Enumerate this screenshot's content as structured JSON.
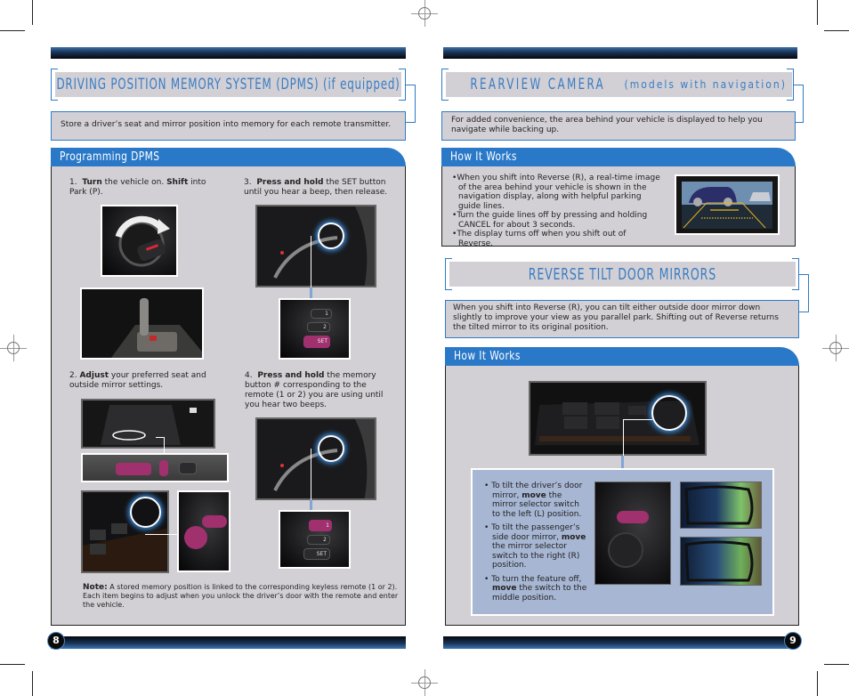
{
  "left_page": {
    "page_number": "8",
    "section_title": "DRIVING POSITION MEMORY SYSTEM (DPMS)",
    "section_title_suffix": "(if equipped)",
    "intro": "Store a driver’s seat and mirror position into memory for each remote transmitter.",
    "panel_title": "Programming DPMS",
    "steps": [
      {
        "num": "1.",
        "bold1": "Turn",
        "text1": " the vehicle on. ",
        "bold2": "Shift",
        "text2": " into Park (P)."
      },
      {
        "num": "2.",
        "bold1": "Adjust",
        "text1": " your preferred seat and outside mirror settings.",
        "bold2": "",
        "text2": ""
      },
      {
        "num": "3.",
        "bold1": "Press and hold",
        "text1": " the SET button until you hear a beep, then release.",
        "bold2": "",
        "text2": ""
      },
      {
        "num": "4.",
        "bold1": "Press and hold",
        "text1": " the memory button #  corresponding to the remote (1 or 2) you are using until you hear two beeps.",
        "bold2": "",
        "text2": ""
      }
    ],
    "note_label": "Note:",
    "note_line1": " A stored memory position is linked to the corresponding keyless remote (1 or 2).",
    "note_line2": "Each item begins to adjust when you unlock the driver’s door with the remote and enter the vehicle.",
    "button_labels": {
      "memory_1": "1",
      "memory_2": "2",
      "set": "SET"
    }
  },
  "right_page": {
    "page_number": "9",
    "camera": {
      "title": "REARVIEW CAMERA",
      "title_suffix": "(models with navigation)",
      "intro": "For added convenience, the area behind your vehicle is displayed to help you navigate while backing up.",
      "panel_title": "How It Works",
      "bullets": [
        "When you shift into Reverse (R), a real-time image of the area behind your vehicle is shown in the navigation display, along with helpful parking guide lines.",
        "Turn the guide lines off by pressing and holding CANCEL for about 3 seconds.",
        "The display turns off when you shift out of Reverse."
      ]
    },
    "mirrors": {
      "title": "REVERSE TILT DOOR MIRRORS",
      "intro": "When you shift into Reverse (R), you can tilt either outside door mirror down slightly to improve your view as you parallel park. Shifting out of Reverse returns the tilted mirror to its original position.",
      "panel_title": "How It Works",
      "bullets": [
        {
          "pre": "To tilt the driver’s door mirror, ",
          "bold": "move",
          "post": " the mirror selector switch to the left (L) position."
        },
        {
          "pre": "To tilt the passenger’s side door mirror, ",
          "bold": "move",
          "post": " the mirror selector switch to the right (R) position."
        },
        {
          "pre": "To turn the feature off, ",
          "bold": "move",
          "post": " the switch to the middle position."
        }
      ]
    }
  },
  "colors": {
    "accent_blue": "#2a78c8",
    "title_text": "#3a7cc4",
    "panel_gray": "#d2d0d4",
    "highlight_magenta": "#a1306f",
    "mirror_box": "#a7b6d3"
  }
}
